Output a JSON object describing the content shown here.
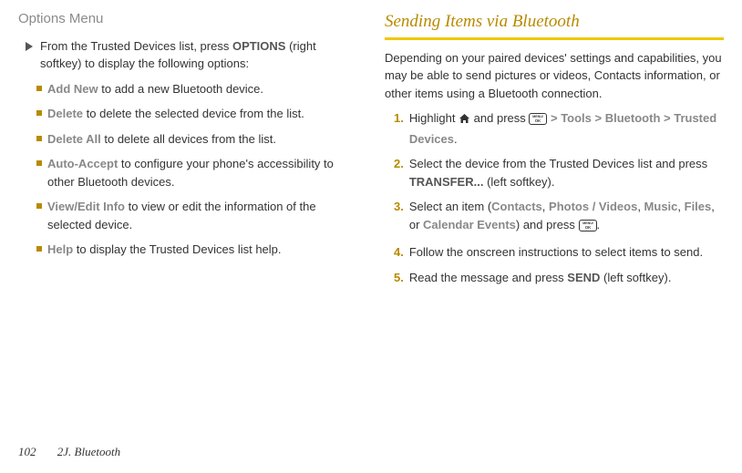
{
  "left": {
    "heading": "Options Menu",
    "intro_a": "From the Trusted Devices list, press ",
    "intro_bold": "OPTIONS",
    "intro_b": " (right softkey) to display the following options:",
    "items": [
      {
        "label": "Add New",
        "text": " to add a new Bluetooth device."
      },
      {
        "label": "Delete",
        "text": " to delete the selected device from the list."
      },
      {
        "label": "Delete All",
        "text": " to delete all devices from the list."
      },
      {
        "label": "Auto-Accept",
        "text": " to configure your phone's accessibility to other Bluetooth devices."
      },
      {
        "label": "View/Edit Info",
        "text": " to view or edit the information of the selected device."
      },
      {
        "label": "Help",
        "text": " to display the Trusted Devices list help."
      }
    ]
  },
  "right": {
    "heading": "Sending Items via Bluetooth",
    "intro": "Depending on your paired devices' settings and capabilities, you may be able to send pictures or videos, Contacts information, or other items using a Bluetooth connection.",
    "step1_a": "Highlight ",
    "step1_b": " and press ",
    "step1_c": " > ",
    "step1_tools": "Tools",
    "step1_bt": "Bluetooth",
    "step1_td": "Trusted Devices",
    "step1_dot": ".",
    "step2_a": "Select the device from the Trusted Devices list and press ",
    "step2_bold": "TRANSFER...",
    "step2_b": " (left softkey).",
    "step3_a": "Select an item (",
    "step3_contacts": "Contacts",
    "step3_sep": ", ",
    "step3_pv": "Photos / Videos",
    "step3_music": "Music",
    "step3_files": "Files",
    "step3_or": ", or ",
    "step3_cal": "Calendar Events",
    "step3_b": ") and press ",
    "step3_dot": ".",
    "step4": "Follow the onscreen instructions to select items to send.",
    "step5_a": "Read the message and press ",
    "step5_bold": "SEND",
    "step5_b": " (left softkey)."
  },
  "footer": {
    "page": "102",
    "section": "2J. Bluetooth"
  }
}
